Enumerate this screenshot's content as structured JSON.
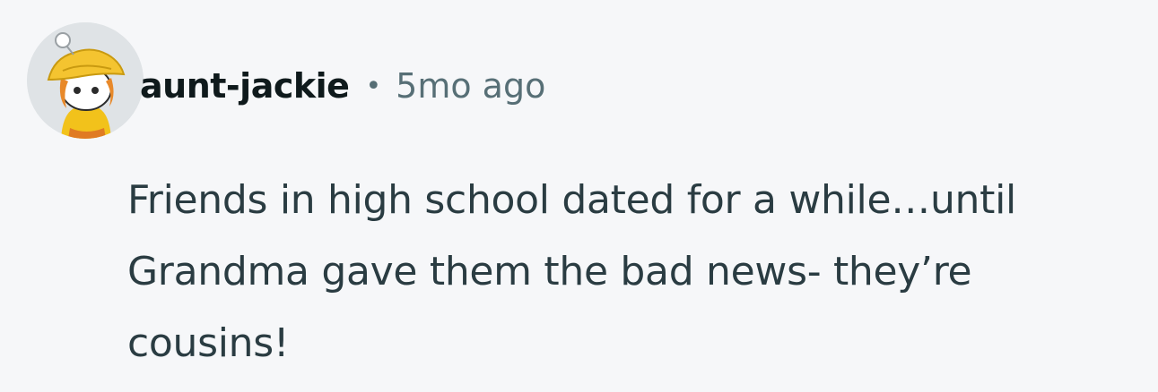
{
  "comment": {
    "author": "aunt-jackie",
    "separator": "•",
    "timestamp": "5mo ago",
    "avatar_icon": "snoo-avatar-icon",
    "body_lines": [
      "Friends in high school dated for a while…until",
      "Grandma gave them the bad news- they’re",
      "cousins!"
    ]
  },
  "colors": {
    "background": "#f6f7f9",
    "username": "#0f1a1c",
    "meta": "#576f76",
    "body": "#2a3c42",
    "hat": "#f4c430",
    "hair": "#e8892a"
  }
}
